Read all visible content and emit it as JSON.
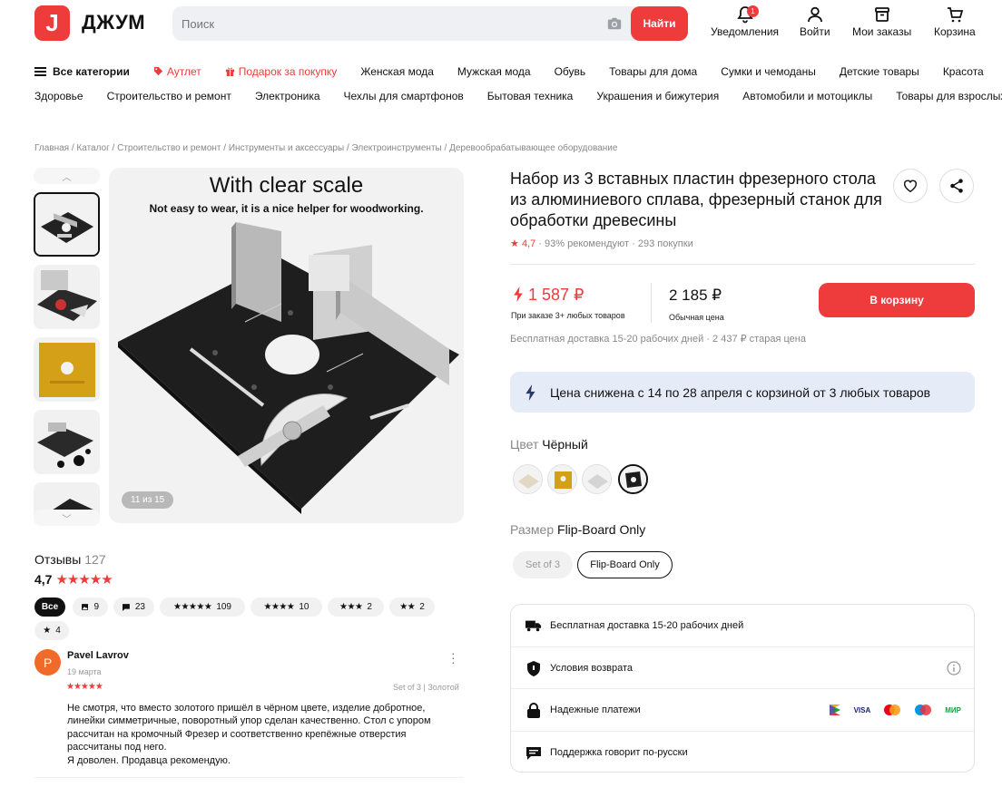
{
  "header": {
    "logo_letter": "J",
    "logo_text": "ДЖУМ",
    "search_placeholder": "Поиск",
    "search_button": "Найти",
    "notifications": {
      "label": "Уведомления",
      "badge": "1"
    },
    "login": "Войти",
    "orders": "Мои заказы",
    "cart": "Корзина"
  },
  "nav": {
    "row1": [
      "Все категории",
      "Аутлет",
      "Подарок за покупку",
      "Женская мода",
      "Мужская мода",
      "Обувь",
      "Товары для дома",
      "Сумки и чемоданы",
      "Детские товары",
      "Красота"
    ],
    "row2": [
      "Здоровье",
      "Строительство и ремонт",
      "Электроника",
      "Чехлы для смартфонов",
      "Бытовая техника",
      "Украшения и бижутерия",
      "Автомобили и мотоциклы",
      "Товары для взрослых"
    ]
  },
  "breadcrumb": [
    "Главная",
    "Каталог",
    "Строительство и ремонт",
    "Инструменты и аксессуары",
    "Электроинструменты",
    "Деревообрабатывающее оборудование"
  ],
  "gallery": {
    "title": "With clear scale",
    "subtitle": "Not easy to wear, it is a nice helper for woodworking.",
    "counter": "11 из 15"
  },
  "product": {
    "title": "Набор из 3 вставных пластин фрезерного стола из алюминиевого сплава, фрезерный станок для обработки древесины",
    "rating": "4,7",
    "recommend": "93% рекомендуют",
    "purchases": "293 покупки",
    "price_sale": "1 587 ₽",
    "price_sale_note": "При заказе 3+ любых товаров",
    "price_regular": "2 185 ₽",
    "price_regular_note": "Обычная цена",
    "cart_button": "В корзину",
    "delivery": "Бесплатная доставка 15-20 рабочих дней",
    "old_price": "2 437 ₽ старая цена",
    "promo": "Цена снижена с 14 по 28 апреля с корзиной от 3 любых товаров",
    "color_label": "Цвет",
    "color_value": "Чёрный",
    "size_label": "Размер",
    "size_value": "Flip-Board Only",
    "sizes": [
      "Set of 3",
      "Flip-Board Only"
    ]
  },
  "info": {
    "delivery": "Бесплатная доставка 15-20 рабочих дней",
    "returns": "Условия возврата",
    "payments": "Надежные платежи",
    "support": "Поддержка говорит по-русски",
    "pay_logos": [
      "VISA",
      "МИР"
    ]
  },
  "reviews": {
    "label": "Отзывы",
    "count": "127",
    "score": "4,7",
    "filters": {
      "all": "Все",
      "photos": "9",
      "comments": "23",
      "five": "109",
      "four": "10",
      "three": "2",
      "two": "2",
      "one": "4"
    },
    "item": {
      "avatar": "P",
      "name": "Pavel Lavrov",
      "date": "19 марта",
      "variant": "Set of 3 | Золотой",
      "text_lines": [
        "Не смотря, что вместо золотого пришёл в чёрном цвете, изделие добротное,",
        "линейки симметричные, поворотный упор сделан качественно. Стол с упором",
        "рассчитан на кромочный Фрезер и соответственно крепёжные отверстия",
        "рассчитаны под него.",
        "Я доволен. Продавца рекомендую."
      ]
    }
  },
  "colors": {
    "accent": "#ee3b3b",
    "promo_bg": "#e6ecf7",
    "avatar": "#f06a2a"
  }
}
